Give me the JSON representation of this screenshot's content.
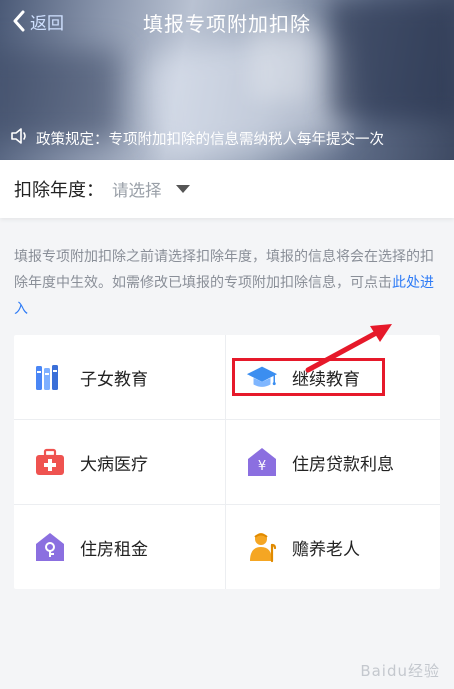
{
  "header": {
    "back_label": "返回",
    "title": "填报专项附加扣除",
    "notice": "政策规定：专项附加扣除的信息需纳税人每年提交一次"
  },
  "year_selector": {
    "label": "扣除年度：",
    "placeholder": "请选择"
  },
  "description": {
    "text": "填报专项附加扣除之前请选择扣除年度，填报的信息将会在选择的扣除年度中生效。如需修改已填报的专项附加扣除信息，可点击",
    "link": "此处进入"
  },
  "categories": [
    {
      "label": "子女教育",
      "icon": "books-icon",
      "color": "#4a86f5"
    },
    {
      "label": "继续教育",
      "icon": "graduation-cap-icon",
      "color": "#3b8ef0"
    },
    {
      "label": "大病医疗",
      "icon": "medical-kit-icon",
      "color": "#ef5350"
    },
    {
      "label": "住房贷款利息",
      "icon": "house-loan-icon",
      "color": "#8b6fe0"
    },
    {
      "label": "住房租金",
      "icon": "house-rent-icon",
      "color": "#8b6fe0"
    },
    {
      "label": "赡养老人",
      "icon": "elder-person-icon",
      "color": "#f5a623"
    }
  ],
  "annotation": {
    "highlight_color": "#e6192a"
  },
  "watermark": "Baidu经验"
}
